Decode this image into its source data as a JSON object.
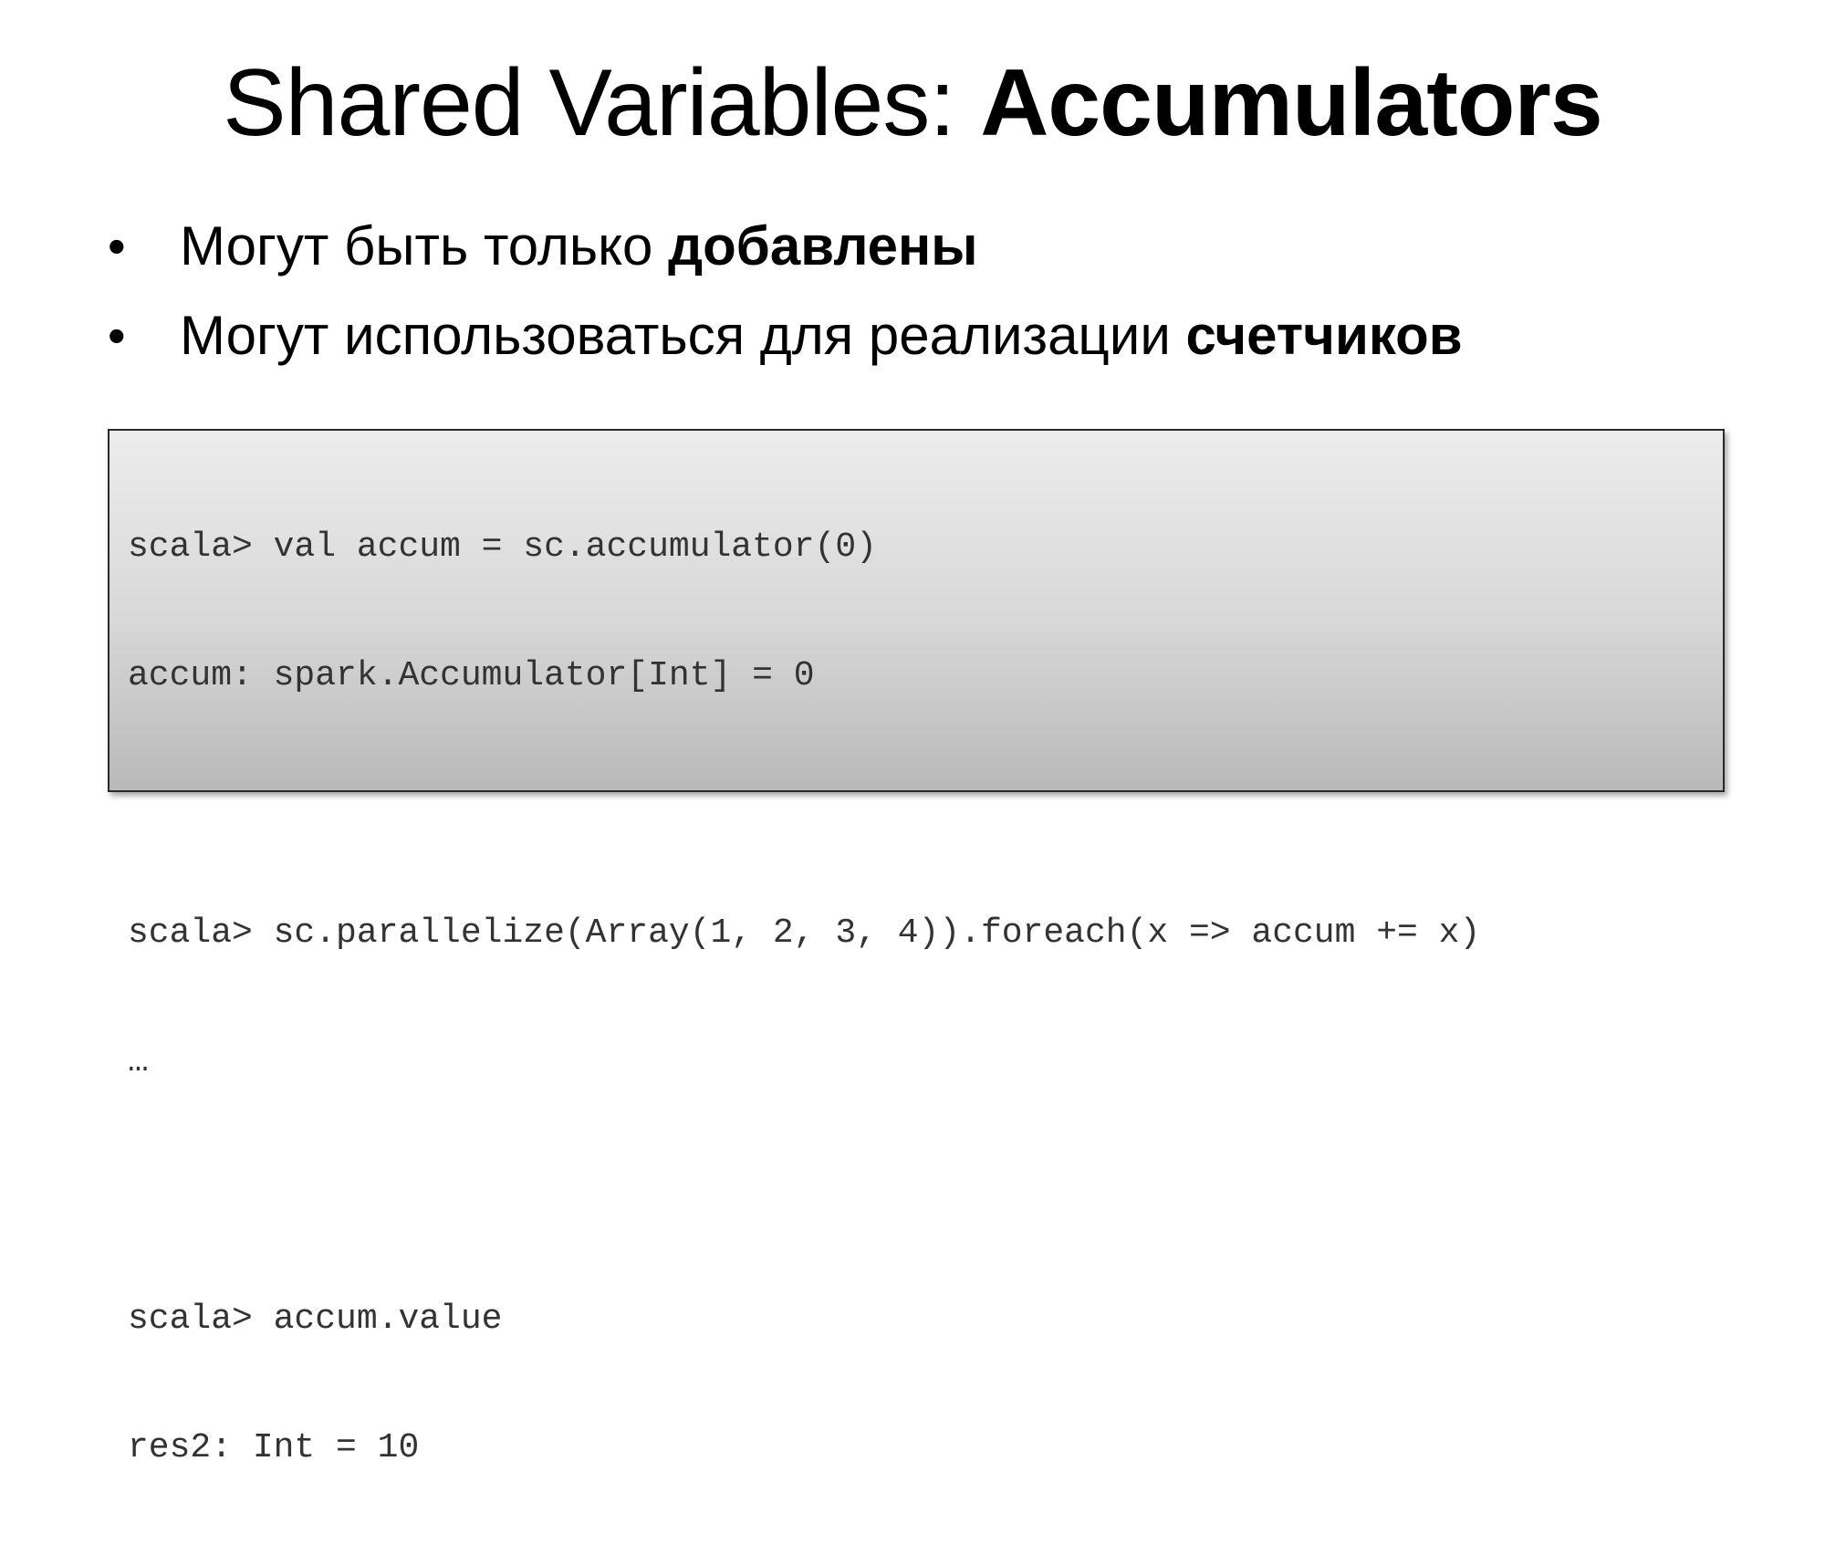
{
  "slide": {
    "title": {
      "regular": "Shared Variables: ",
      "bold": "Accumulators"
    },
    "bullets": [
      {
        "marker": "•",
        "text_regular": "Могут быть только ",
        "text_bold": "добавлены"
      },
      {
        "marker": "•",
        "text_regular": "Могут использоваться для реализации ",
        "text_bold": "счетчиков"
      }
    ],
    "code": {
      "lines": [
        "scala> val accum = sc.accumulator(0)",
        "accum: spark.Accumulator[Int] = 0",
        "",
        "scala> sc.parallelize(Array(1, 2, 3, 4)).foreach(x => accum += x)",
        "…",
        "",
        "scala> accum.value",
        "res2: Int = 10"
      ]
    }
  }
}
